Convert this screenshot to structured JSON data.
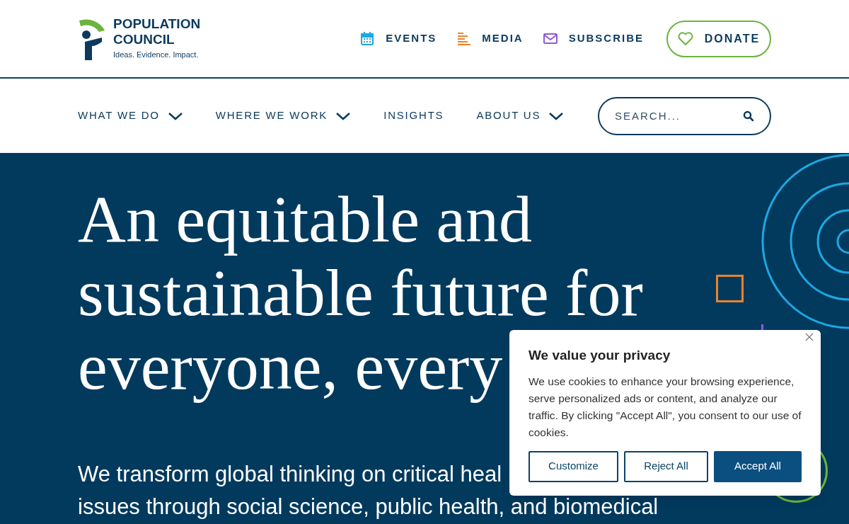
{
  "logo": {
    "line_1": "POPULATION",
    "line_2": "COUNCIL",
    "tagline": "Ideas. Evidence. Impact."
  },
  "utility_nav": [
    {
      "label": "EVENTS",
      "kind": "events"
    },
    {
      "label": "MEDIA",
      "kind": "media"
    },
    {
      "label": "SUBSCRIBE",
      "kind": "subscribe"
    }
  ],
  "donate_button": {
    "label": "DONATE"
  },
  "main_nav": [
    {
      "label": "WHAT WE DO",
      "has_dropdown": true
    },
    {
      "label": "WHERE WE WORK",
      "has_dropdown": true
    },
    {
      "label": "INSIGHTS",
      "has_dropdown": false
    },
    {
      "label": "ABOUT US",
      "has_dropdown": true
    }
  ],
  "search": {
    "placeholder": "SEARCH..."
  },
  "hero": {
    "heading_lines": [
      "An equitable and",
      "sustainable future for",
      "everyone, every"
    ],
    "paragraph_lines": [
      "We transform global thinking on critical heal",
      "issues through social science, public health, and biomedical"
    ]
  },
  "cookie_banner": {
    "title": "We value your privacy",
    "body": "We use cookies to enhance your browsing experience, serve personalized ads or content, and analyze our traffic. By clicking \"Accept All\", you consent to our use of cookies.",
    "buttons": [
      {
        "label": "Customize",
        "kind": "outline"
      },
      {
        "label": "Reject All",
        "kind": "outline"
      },
      {
        "label": "Accept All",
        "kind": "primary"
      }
    ]
  }
}
